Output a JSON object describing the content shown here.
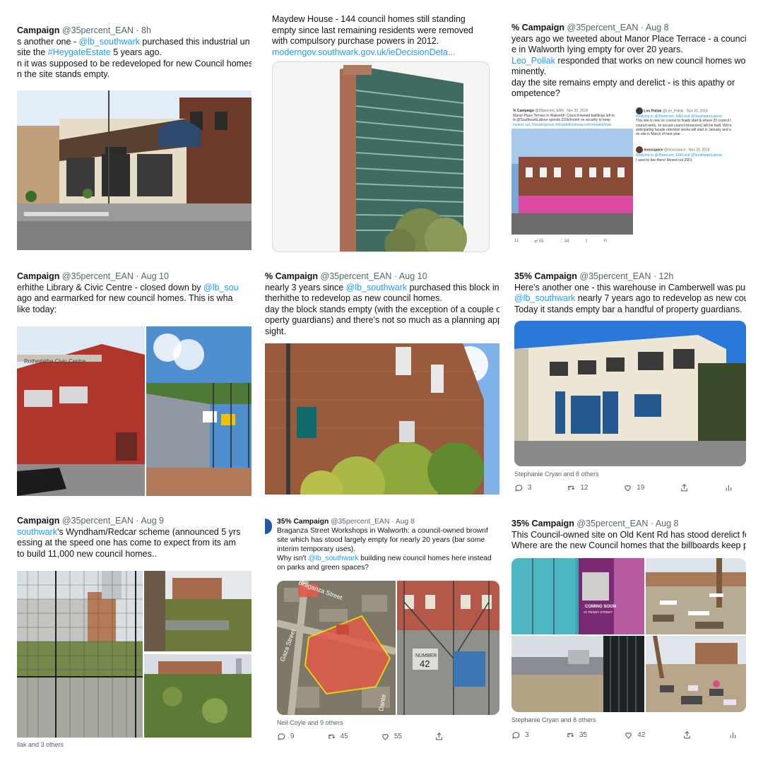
{
  "tiles": [
    {
      "header": {
        "name": "Campaign",
        "handle": "@35percent_EAN",
        "time": "8h"
      },
      "lines": [
        [
          "s another one - ",
          "@lb_southwark",
          " purchased this industrial un"
        ],
        [
          "site the ",
          "#HeygateEstate",
          " 5 years ago."
        ],
        [
          "n it was supposed to be redeveloped for new Council homes"
        ],
        [
          "n the site stands empty."
        ]
      ]
    },
    {
      "header": {},
      "lines": [
        [
          "Maydew House - 144 council homes still standing"
        ],
        [
          "empty since last remaining residents were removed"
        ],
        [
          "with compulsory purchase powers in 2012."
        ],
        [
          "moderngov.southwark.gov.uk/ieDecisionDeta..."
        ]
      ]
    },
    {
      "header": {
        "name": "% Campaign",
        "handle": "@35percent_EAN",
        "time": "Aug 8"
      },
      "lines": [
        [
          "years ago we tweeted about Manor Place Terrace - a council-ow"
        ],
        [
          "e in Walworth lying empty for over 20 years."
        ],
        [
          "Leo_Pollak",
          " responded that works on new council homes would s"
        ],
        [
          "minently."
        ],
        [
          "day the site remains empty and derelict - is this apathy or"
        ],
        [
          "ompetence?"
        ]
      ],
      "embedded": {
        "name": "% Campaign",
        "handle": "@35percent_EAN · Nov 20, 2018",
        "text": [
          "Manor Place Terrace in Walworth: Council-owned buildings left to",
          "le @SouthwarkLabour spends £15k/month on security to keep",
          "ineless out. #housingcrisis #whatdotheyknow.com/request/man"
        ],
        "reply1_name": "Leo Pollak",
        "reply1_handle": "@Leo_Pollak · Nov 20, 2018",
        "reply1_text": [
          "Replying to @35percent_EAN and @SouthwarkLabour",
          "This site is now on course to finally start & where 20 council t",
          "council rents, on secure council tenancies) will be built. We're",
          "anticipating facade retention works will start in January and a",
          "on site in March of next year"
        ],
        "reply2_name": "mossspace",
        "reply2_handle": "@mossspace · Nov 20, 2018",
        "reply2_text": [
          "Replying to @35percent_EAN and @SouthwarkLabour",
          "I used to live there! Moved out 2001"
        ],
        "counts": [
          "11",
          "55",
          "34"
        ]
      }
    },
    {
      "header": {
        "name": "Campaign",
        "handle": "@35percent_EAN",
        "time": "Aug 10"
      },
      "lines": [
        [
          "erhithe Library & Civic Centre - closed down by ",
          "@lb_sou"
        ],
        [
          " ago and earmarked for new council homes. This is wha"
        ],
        [
          " like today:"
        ]
      ]
    },
    {
      "header": {
        "name": "% Campaign",
        "handle": "@35percent_EAN",
        "time": "Aug 10"
      },
      "lines": [
        [
          " nearly 3 years since ",
          "@lb_southwark",
          " purchased this block in"
        ],
        [
          "therhithe to redevelop as new council homes."
        ],
        [
          "day the block stands empty (with the exception of a couple of"
        ],
        [
          "operty guardians) and there's not so much as a planning applic"
        ],
        [
          "sight."
        ]
      ]
    },
    {
      "header": {
        "name": "35% Campaign",
        "handle": "@35percent_EAN",
        "time": "12h"
      },
      "lines": [
        [
          "Here's another one - this warehouse in Camberwell was purcha"
        ],
        [
          "@lb_southwark",
          " nearly 7 years ago to redevelop as new council h"
        ],
        [
          "Today it stands empty bar a handful of property guardians."
        ]
      ],
      "likers": "Stephanie Cryan and 8 others",
      "counts": {
        "reply": "3",
        "retweet": "12",
        "like": "19"
      }
    },
    {
      "header": {
        "name": "Campaign",
        "handle": "@35percent_EAN",
        "time": "Aug 9"
      },
      "lines": [
        [
          "southwark",
          "'s Wyndham/Redcar scheme (announced 5 yrs"
        ],
        [
          "essing at the speed one has come to expect from its am"
        ],
        [
          " to build 11,000 new council homes.."
        ]
      ],
      "likers": "llak and 3 others"
    },
    {
      "header": {
        "name": "35% Campaign",
        "handle": "@35percent_EAN",
        "time": "Aug 8"
      },
      "lines": [
        [
          "Braganza Street Workshops in Walworth: a council-owned brownf"
        ],
        [
          "site which has stood largely empty for nearly 20 years (bar some"
        ],
        [
          "interim temporary uses)."
        ],
        [
          "Why isn't ",
          "@lb_southwark",
          " building new council homes here instead"
        ],
        [
          "on parks and green spaces?"
        ]
      ],
      "map_labels": [
        "Braganza Street",
        "Gaza Street",
        "Dante"
      ],
      "sign_text": [
        "NUMBER",
        "42"
      ],
      "likers": "Neil Coyle and 9 others",
      "counts": {
        "reply": "9",
        "retweet": "45",
        "like": "55"
      }
    },
    {
      "header": {
        "name": "35% Campaign",
        "handle": "@35percent_EAN",
        "time": "Aug 8"
      },
      "lines": [
        [
          "This Council-owned site on Old Kent Rd has stood derelict for"
        ],
        [
          "Where are the new Council homes that the billboards keep pro"
        ]
      ],
      "billboard": [
        "COMING SOON",
        "AT PENNY STREET"
      ],
      "likers": "Stephanie Cryan and 8 others",
      "counts": {
        "reply": "3",
        "retweet": "35",
        "like": "42"
      }
    }
  ]
}
